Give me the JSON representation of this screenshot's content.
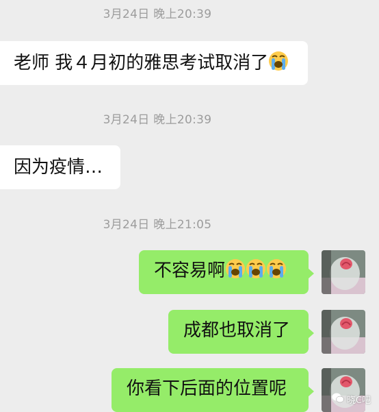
{
  "chat": {
    "messages": [
      {
        "timestamp": "3月24日 晚上20:39",
        "side": "left",
        "text": "老师 我４月初的雅思考试取消了",
        "emoji_count": 1
      },
      {
        "timestamp": "3月24日 晚上20:39",
        "side": "left",
        "text": "因为疫情…",
        "emoji_count": 0
      },
      {
        "timestamp": "3月24日 晚上21:05",
        "side": "right",
        "text": "不容易啊",
        "emoji_count": 3
      },
      {
        "side": "right",
        "text": "成都也取消了",
        "emoji_count": 0
      },
      {
        "side": "right",
        "text": "你看下后面的位置呢",
        "emoji_count": 0
      }
    ]
  },
  "emoji": {
    "name": "loudly-crying-face-icon",
    "color": "#ffcc4d"
  },
  "colors": {
    "background": "#ededed",
    "received_bubble": "#ffffff",
    "sent_bubble": "#95ec69"
  },
  "watermark": {
    "text": "晓C吧"
  }
}
